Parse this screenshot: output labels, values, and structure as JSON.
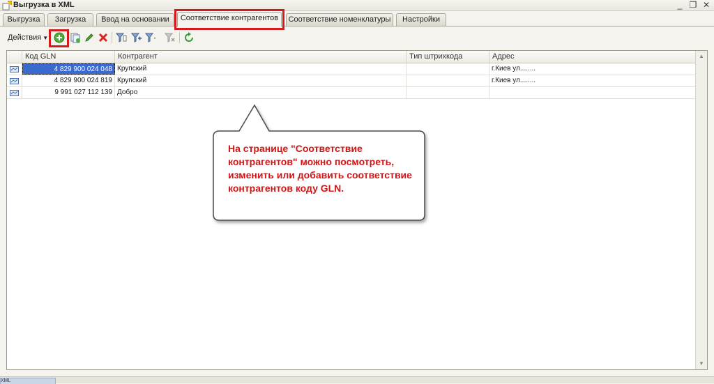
{
  "window": {
    "title": "Выгрузка  в XML",
    "minimize_icon": "minimize-icon",
    "restore_icon": "restore-icon",
    "close_icon": "close-icon"
  },
  "tabs": [
    {
      "label": "Выгрузка"
    },
    {
      "label": "Загрузка"
    },
    {
      "label": "Ввод на основании"
    },
    {
      "label": "Соответствие контрагентов",
      "active": true
    },
    {
      "label": "Соответствие номенклатуры"
    },
    {
      "label": "Настройки"
    }
  ],
  "toolbar": {
    "actions_label": "Действия"
  },
  "grid": {
    "columns": [
      "Код GLN",
      "Контрагент",
      "Тип штрихкода",
      "Адрес"
    ],
    "rows": [
      {
        "gln": "4 829 900 024 048",
        "contractor": "Крупский",
        "barcode_type": "",
        "address": "г.Киев ул........"
      },
      {
        "gln": "4 829 900 024 819",
        "contractor": "Крупский",
        "barcode_type": "",
        "address": "г.Киев ул........"
      },
      {
        "gln": "9 991 027 112 139",
        "contractor": "Добро",
        "barcode_type": "",
        "address": ""
      }
    ]
  },
  "callout": {
    "text": "На странице \"Соответствие контрагентов\" можно посмотреть, изменить или добавить соответствие контрагентов коду GLN."
  },
  "statusbar": {
    "tab_label": "XML"
  },
  "colors": {
    "highlight": "#d41a1a",
    "callout_text": "#d41414",
    "selection": "#3a6ad0"
  }
}
